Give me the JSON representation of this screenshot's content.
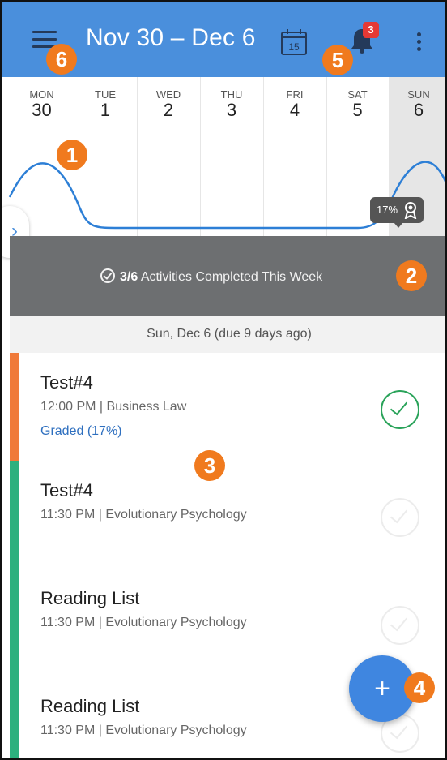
{
  "header": {
    "title": "Nov 30 – Dec 6",
    "calendar_day": "15",
    "notification_count": "3",
    "colors": {
      "bar": "#4a8fdc",
      "badge": "#e53935"
    }
  },
  "callouts": [
    "1",
    "2",
    "3",
    "4",
    "5",
    "6"
  ],
  "week": {
    "days": [
      {
        "dow": "MON",
        "num": "30"
      },
      {
        "dow": "TUE",
        "num": "1"
      },
      {
        "dow": "WED",
        "num": "2"
      },
      {
        "dow": "THU",
        "num": "3"
      },
      {
        "dow": "FRI",
        "num": "4"
      },
      {
        "dow": "SAT",
        "num": "5"
      },
      {
        "dow": "SUN",
        "num": "6"
      }
    ],
    "selected_index": 6,
    "grade_pill": "17%"
  },
  "summary": {
    "count": "3/6",
    "text": " Activities Completed This Week"
  },
  "date_header": "Sun, Dec 6 (due 9 days ago)",
  "activities": [
    {
      "title": "Test#4",
      "meta": "12:00 PM | Business Law",
      "grade": "Graded (17%)",
      "color": "#f07a3a",
      "completed": true
    },
    {
      "title": "Test#4",
      "meta": "11:30 PM | Evolutionary Psychology",
      "grade": "",
      "color": "#2db07e",
      "completed": false
    },
    {
      "title": "Reading List",
      "meta": "11:30 PM | Evolutionary Psychology",
      "grade": "",
      "color": "#2db07e",
      "completed": false
    },
    {
      "title": "Reading List",
      "meta": "11:30 PM | Evolutionary Psychology",
      "grade": "",
      "color": "#2db07e",
      "completed": false
    }
  ],
  "fab_label": "+"
}
